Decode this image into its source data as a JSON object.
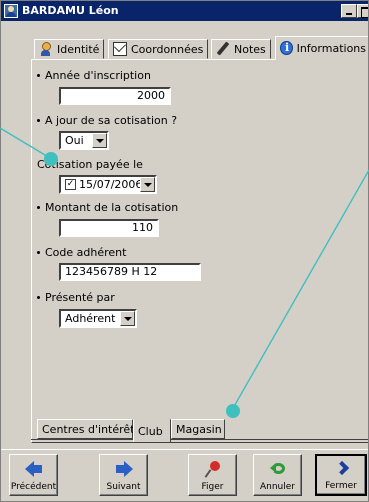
{
  "window": {
    "title": "BARDAMU Léon"
  },
  "top_tabs": [
    {
      "label": "Identité",
      "icon": "person-icon"
    },
    {
      "label": "Coordonnées",
      "icon": "envelope-icon"
    },
    {
      "label": "Notes",
      "icon": "pencil-icon"
    },
    {
      "label": "Informations",
      "icon": "info-icon",
      "active": true
    }
  ],
  "form": {
    "annee_label": "Année d'inscription",
    "annee_value": "2000",
    "ajour_label": "A jour de sa cotisation ?",
    "ajour_value": "Oui",
    "cotisation_label": "Cotisation payée le",
    "cotisation_checked": "✓",
    "cotisation_date": "15/07/2006",
    "montant_label": "Montant de la cotisation",
    "montant_value": "110",
    "code_label": "Code adhérent",
    "code_value": "123456789 H 12",
    "presente_label": "Présenté par",
    "presente_value": "Adhérent"
  },
  "bottom_tabs": [
    {
      "label": "Centres d'intérêt"
    },
    {
      "label": "Club",
      "active": true
    },
    {
      "label": "Magasin"
    }
  ],
  "toolbar": {
    "precedent": "Précédent",
    "suivant": "Suivant",
    "figer": "Figer",
    "annuler": "Annuler",
    "fermer": "Fermer"
  },
  "colors": {
    "titlebar": "#0a246a",
    "callout": "#40bfbf",
    "face": "#d4d0c8"
  }
}
